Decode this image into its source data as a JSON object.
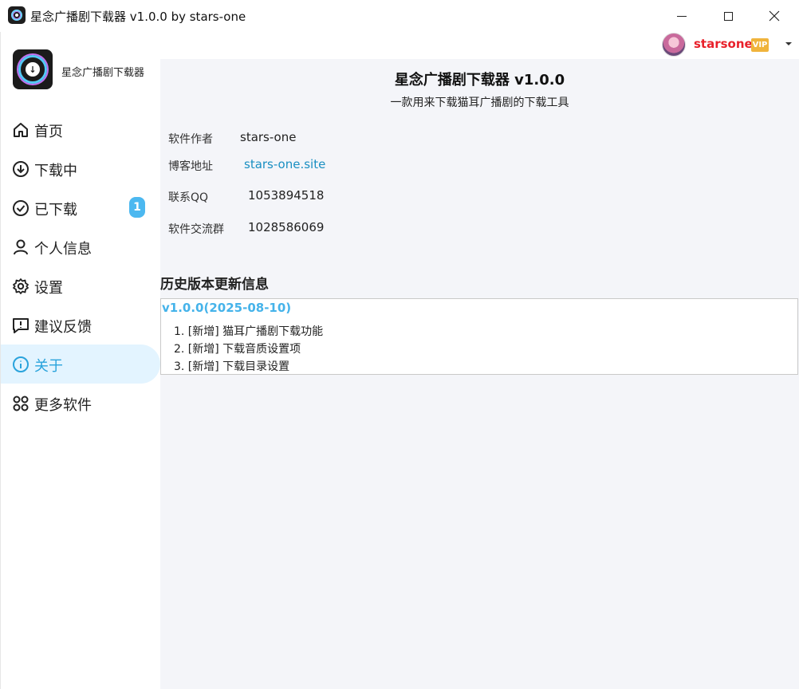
{
  "window": {
    "title": "星念广播剧下载器 v1.0.0 by stars-one"
  },
  "user": {
    "name": "starsone",
    "badge": "VIP"
  },
  "sidebar": {
    "app_name": "星念广播剧下载器",
    "items": [
      {
        "label": "首页",
        "icon": "home-icon"
      },
      {
        "label": "下载中",
        "icon": "download-icon"
      },
      {
        "label": "已下载",
        "icon": "check-circle-icon",
        "badge": "1"
      },
      {
        "label": "个人信息",
        "icon": "person-icon"
      },
      {
        "label": "设置",
        "icon": "gear-icon"
      },
      {
        "label": "建议反馈",
        "icon": "feedback-icon"
      },
      {
        "label": "关于",
        "icon": "info-icon",
        "active": true
      },
      {
        "label": "更多软件",
        "icon": "apps-icon"
      }
    ]
  },
  "about": {
    "title": "星念广播剧下载器 v1.0.0",
    "subtitle": "一款用来下载猫耳广播剧的下载工具",
    "info": [
      {
        "label": "软件作者",
        "value": "stars-one"
      },
      {
        "label": "博客地址",
        "value": "stars-one.site"
      },
      {
        "label": "联系QQ",
        "value": "1053894518"
      },
      {
        "label": "软件交流群",
        "value": "1028586069"
      }
    ]
  },
  "history": {
    "title": "历史版本更新信息",
    "versions": [
      {
        "version": "v1.0.0(2025-08-10)",
        "changes": [
          "1. [新增] 猫耳广播剧下载功能",
          "2. [新增] 下载音质设置项",
          "3. [新增] 下载目录设置"
        ]
      }
    ]
  },
  "colors": {
    "accent": "#2aa3dc",
    "active_bg": "#e3f4ff",
    "username": "#e8202a",
    "vip": "#f0b43c",
    "version": "#45b3ea",
    "link": "#1a8fc2",
    "content_bg": "#f4f5f9"
  }
}
